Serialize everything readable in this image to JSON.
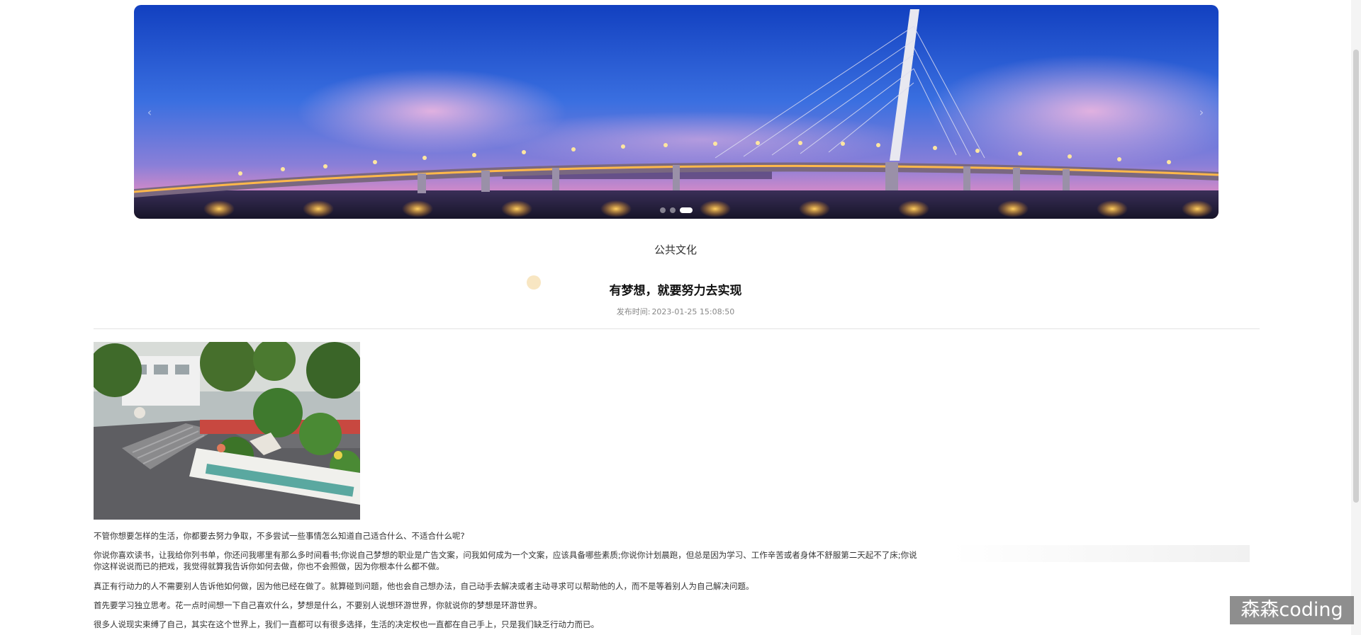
{
  "carousel": {
    "prev_glyph": "‹",
    "next_glyph": "›",
    "slide_count": 3,
    "active_slide": 3
  },
  "article": {
    "category": "公共文化",
    "title": "有梦想，就要努力去实现",
    "published_label": "发布时间:",
    "published_time": "2023-01-25 15:08:50",
    "paragraphs": [
      "不管你想要怎样的生活，你都要去努力争取，不多尝试一些事情怎么知道自己适合什么、不适合什么呢?",
      "你说你喜欢读书，让我给你列书单，你还问我哪里有那么多时间看书;你说自己梦想的职业是广告文案，问我如何成为一个文案，应该具备哪些素质;你说你计划晨跑，但总是因为学习、工作辛苦或者身体不舒服第二天起不了床;你说",
      "你这样说说而已的把戏，我觉得就算我告诉你如何去做，你也不会照做，因为你根本什么都不做。",
      "真正有行动力的人不需要别人告诉他如何做，因为他已经在做了。就算碰到问题，他也会自己想办法，自己动手去解决或者主动寻求可以帮助他的人，而不是等着别人为自己解决问题。",
      "首先要学习独立思考。花一点时间想一下自己喜欢什么，梦想是什么，不要别人说想环游世界，你就说你的梦想是环游世界。",
      "很多人说现实束缚了自己，其实在这个世界上，我们一直都可以有很多选择，生活的决定权也一直都在自己手上，只是我们缺乏行动力而已。"
    ]
  },
  "watermark": "森森coding",
  "colors": {
    "sky_top": "#1848c8",
    "sky_mid": "#3b78e0",
    "sunset": "#d98acb",
    "lights": "#ffb020",
    "water": "#1a1830"
  }
}
